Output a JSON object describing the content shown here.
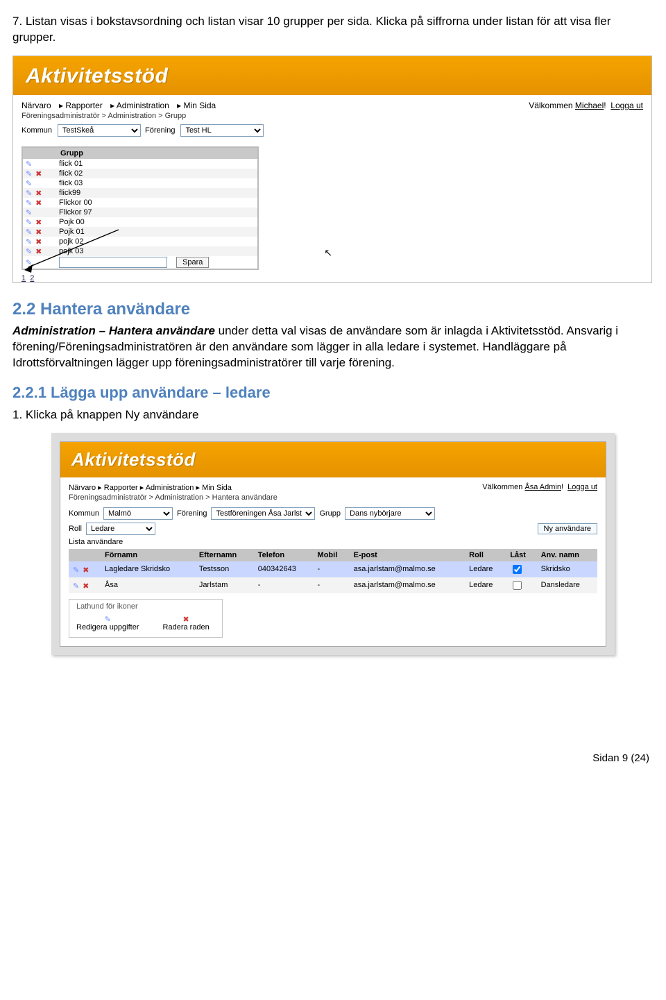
{
  "doc": {
    "intro_text": "7. Listan visas i bokstavsordning och listan visar 10 grupper per sida. Klicka på siffrorna under listan för att visa fler grupper.",
    "section_2_2": "2.2 Hantera användare",
    "para_2_2_a_prefix": "Administration – Hantera användare",
    "para_2_2_a_rest": " under detta val visas de användare som är inlagda i Aktivitetsstöd. Ansvarig i förening/Föreningsadministratören är den användare som lägger in alla ledare i systemet. Handläggare på Idrottsförvaltningen lägger upp föreningsadministratörer till varje förening.",
    "section_2_2_1": "2.2.1 Lägga upp användare – ledare",
    "step1": "1. Klicka på knappen Ny användare",
    "footer": "Sidan 9 (24)"
  },
  "app": {
    "title": "Aktivitetsstöd",
    "menu": [
      "Närvaro",
      "Rapporter",
      "Administration",
      "Min Sida"
    ],
    "breadcrumb1": "Föreningsadministratör > Administration > Grupp",
    "welcome1_prefix": "Välkommen ",
    "welcome1_user": "Michael",
    "logout": "Logga ut",
    "label_kommun": "Kommun",
    "val_kommun1": "TestSkeå",
    "label_forening": "Förening",
    "val_forening1": "Test HL",
    "grp_header": "Grupp",
    "groups": [
      "flick 01",
      "flick 02",
      "flick 03",
      "flick99",
      "Flickor 00",
      "Flickor 97",
      "Pojk 00",
      "Pojk 01",
      "pojk 02",
      "pojk 03"
    ],
    "spara": "Spara",
    "pager": [
      "1",
      "2"
    ],
    "breadcrumb2": "Föreningsadministratör > Administration > Hantera användare",
    "welcome2_user": "Åsa Admin",
    "val_kommun2": "Malmö",
    "val_forening2": "Testföreningen Åsa Jarlstar",
    "label_grupp": "Grupp",
    "val_grupp2": "Dans nybörjare",
    "label_roll": "Roll",
    "val_roll2": "Ledare",
    "list_caption": "Lista användare",
    "btn_new_user": "Ny användare",
    "user_cols": [
      "",
      "Förnamn",
      "Efternamn",
      "Telefon",
      "Mobil",
      "E-post",
      "Roll",
      "Låst",
      "Anv. namn"
    ],
    "users": [
      {
        "fornamn": "Lagledare Skridsko",
        "efternamn": "Testsson",
        "telefon": "040342643",
        "mobil": "-",
        "epost": "asa.jarlstam@malmo.se",
        "roll": "Ledare",
        "last": true,
        "anv": "Skridsko"
      },
      {
        "fornamn": "Åsa",
        "efternamn": "Jarlstam",
        "telefon": "-",
        "mobil": "-",
        "epost": "asa.jarlstam@malmo.se",
        "roll": "Ledare",
        "last": false,
        "anv": "Dansledare"
      }
    ],
    "legend_title": "Lathund för ikoner",
    "legend_edit": "Redigera uppgifter",
    "legend_delete": "Radera raden"
  }
}
